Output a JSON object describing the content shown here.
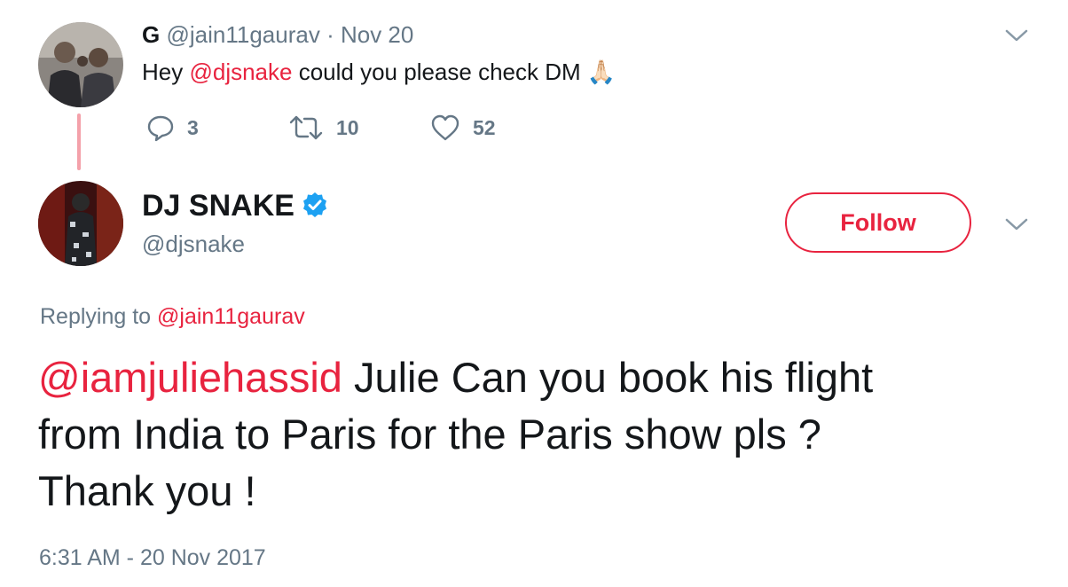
{
  "parent_tweet": {
    "display_name": "G",
    "handle": "@jain11gaurav",
    "separator": "·",
    "date": "Nov 20",
    "text_before": "Hey ",
    "mention": "@djsnake",
    "text_after": " could you please check DM ",
    "emoji": "🙏🏻",
    "actions": {
      "replies": "3",
      "retweets": "10",
      "likes": "52"
    }
  },
  "reply_tweet": {
    "display_name": "DJ SNAKE",
    "verified": true,
    "handle": "@djsnake",
    "follow_label": "Follow",
    "replying_to_label": "Replying to ",
    "replying_to_handle": "@jain11gaurav",
    "mention": "@iamjuliehassid",
    "body_line1_rest": " Julie Can you book his flight",
    "body_line2": "from India to Paris for the Paris show pls ?",
    "body_line3": "Thank you !",
    "timestamp": "6:31 AM - 20 Nov 2017"
  },
  "icons": [
    "reply-icon",
    "retweet-icon",
    "like-icon",
    "chevron-down-icon",
    "verified-badge-icon"
  ],
  "colors": {
    "accent": "#e8233f",
    "thread_line": "#f4a1aa",
    "muted_text": "#657786",
    "verified": "#1da1f2"
  }
}
